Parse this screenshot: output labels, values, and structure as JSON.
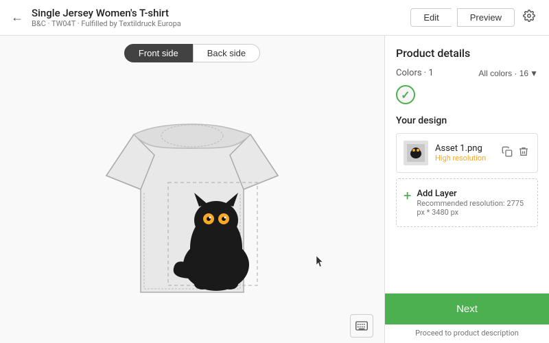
{
  "header": {
    "title": "Single Jersey Women's T-shirt",
    "subtitle": "B&C · TW04T · Fulfilled by Textildruck Europa",
    "edit_label": "Edit",
    "preview_label": "Preview"
  },
  "tabs": {
    "front_side": "Front side",
    "back_side": "Back side"
  },
  "right_panel": {
    "title": "Product details",
    "colors_label": "Colors · 1",
    "all_colors_label": "All colors · 16",
    "your_design_label": "Your design",
    "asset": {
      "name": "Asset 1.png",
      "status": "High resolution"
    },
    "add_layer": {
      "label": "Add Layer",
      "recommendation": "Recommended resolution: 2775 px * 3480 px"
    },
    "next_label": "Next",
    "proceed_label": "Proceed to product description"
  }
}
